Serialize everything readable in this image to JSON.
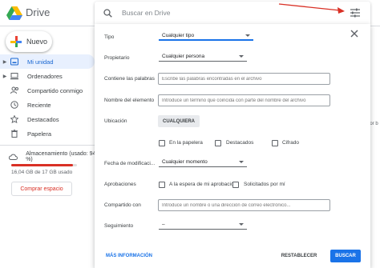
{
  "app": {
    "title": "Drive"
  },
  "sidebar": {
    "new_label": "Nuevo",
    "items": [
      {
        "label": "Mi unidad",
        "icon": "my-drive-icon",
        "caret": "▶",
        "active": true
      },
      {
        "label": "Ordenadores",
        "icon": "computers-icon",
        "caret": "▶",
        "active": false
      },
      {
        "label": "Compartido conmigo",
        "icon": "shared-icon",
        "caret": "",
        "active": false
      },
      {
        "label": "Reciente",
        "icon": "clock-icon",
        "caret": "",
        "active": false
      },
      {
        "label": "Destacados",
        "icon": "star-icon",
        "caret": "",
        "active": false
      },
      {
        "label": "Papelera",
        "icon": "trash-icon",
        "caret": "",
        "active": false
      }
    ],
    "storage_label": "Almacenamiento (usado: 94 %)",
    "storage_used_fraction": 0.94,
    "storage_text": "16,04 GB de 17 GB usado",
    "buy_label": "Comprar espacio"
  },
  "right_stub": "ior b",
  "search": {
    "placeholder": "Buscar en Drive"
  },
  "panel": {
    "tipo_label": "Tipo",
    "tipo_value": "Cualquier tipo",
    "propietario_label": "Propietario",
    "propietario_value": "Cualquier persona",
    "contiene_label": "Contiene las palabras",
    "contiene_placeholder": "Escribe las palabras encontradas en el archivo",
    "nombre_label": "Nombre del elemento",
    "nombre_placeholder": "Introduce un término que coincida con parte del nombre del archivo",
    "ubicacion_label": "Ubicación",
    "ubicacion_button": "CUALQUIERA",
    "ubicacion_checks": [
      "En la papelera",
      "Destacados",
      "Cifrado"
    ],
    "fecha_label": "Fecha de modificaci...",
    "fecha_value": "Cualquier momento",
    "aprobaciones_label": "Aprobaciones",
    "aprobaciones_checks": [
      "A la espera de mi aprobación",
      "Solicitados por mí"
    ],
    "compartido_label": "Compartido con",
    "compartido_placeholder": "Introduce un nombre o una dirección de correo electrónico...",
    "seguimiento_label": "Seguimiento",
    "seguimiento_value": "–",
    "more_info": "MÁS INFORMACIÓN",
    "reset": "RESTABLECER",
    "search": "BUSCAR"
  },
  "colors": {
    "accent": "#1a73e8",
    "annotation": "#d93025"
  }
}
